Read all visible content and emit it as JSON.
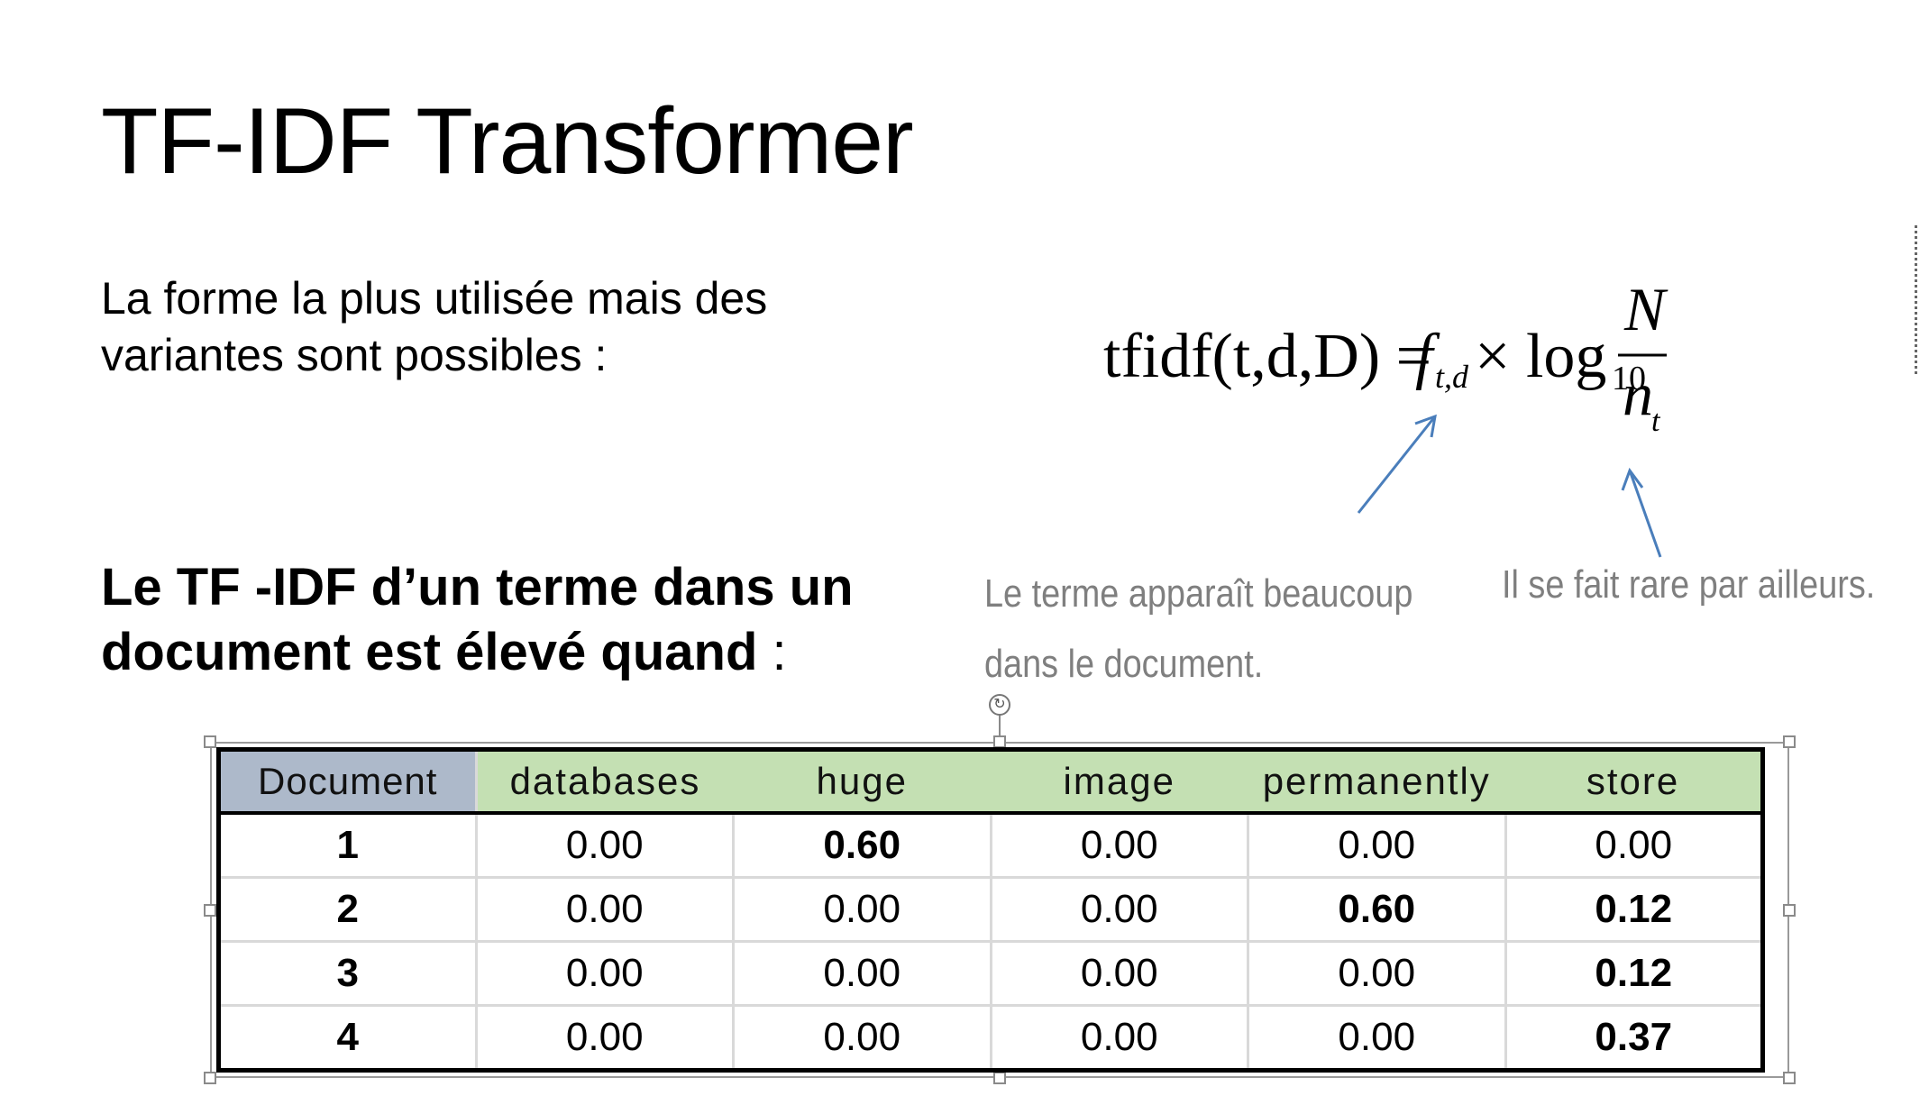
{
  "slide": {
    "title": "TF-IDF Transformer",
    "intro": "La forme la plus utilisée mais des variantes sont possibles :",
    "claim_bold": "Le TF -IDF d’un terme dans un document est élevé quand",
    "claim_colon": " :"
  },
  "formula": {
    "lhs": "tfidf(t,d,D) =",
    "f": "f",
    "f_sub": "t,d",
    "times_log": "× log",
    "log_base": "10",
    "numerator": "N",
    "denominator": "n",
    "denominator_sub": "t"
  },
  "annotations": {
    "left_line1": "Le terme apparaît beaucoup",
    "left_line2": "dans le document.",
    "right": "Il se fait rare par ailleurs."
  },
  "table": {
    "header_doc": "Document",
    "columns": [
      "databases",
      "huge",
      "image",
      "permanently",
      "store"
    ],
    "rows": [
      {
        "doc": "1",
        "values": [
          "0.00",
          "0.60",
          "0.00",
          "0.00",
          "0.00"
        ],
        "bold": [
          false,
          true,
          false,
          false,
          false
        ]
      },
      {
        "doc": "2",
        "values": [
          "0.00",
          "0.00",
          "0.00",
          "0.60",
          "0.12"
        ],
        "bold": [
          false,
          false,
          false,
          true,
          true
        ]
      },
      {
        "doc": "3",
        "values": [
          "0.00",
          "0.00",
          "0.00",
          "0.00",
          "0.12"
        ],
        "bold": [
          false,
          false,
          false,
          false,
          true
        ]
      },
      {
        "doc": "4",
        "values": [
          "0.00",
          "0.00",
          "0.00",
          "0.00",
          "0.37"
        ],
        "bold": [
          false,
          false,
          false,
          false,
          true
        ]
      }
    ]
  },
  "colors": {
    "header_doc_bg": "#adb9ca",
    "header_bg": "#c4e0b3",
    "arrow": "#4a7ebb",
    "annotation_text": "#7f7f7f"
  }
}
